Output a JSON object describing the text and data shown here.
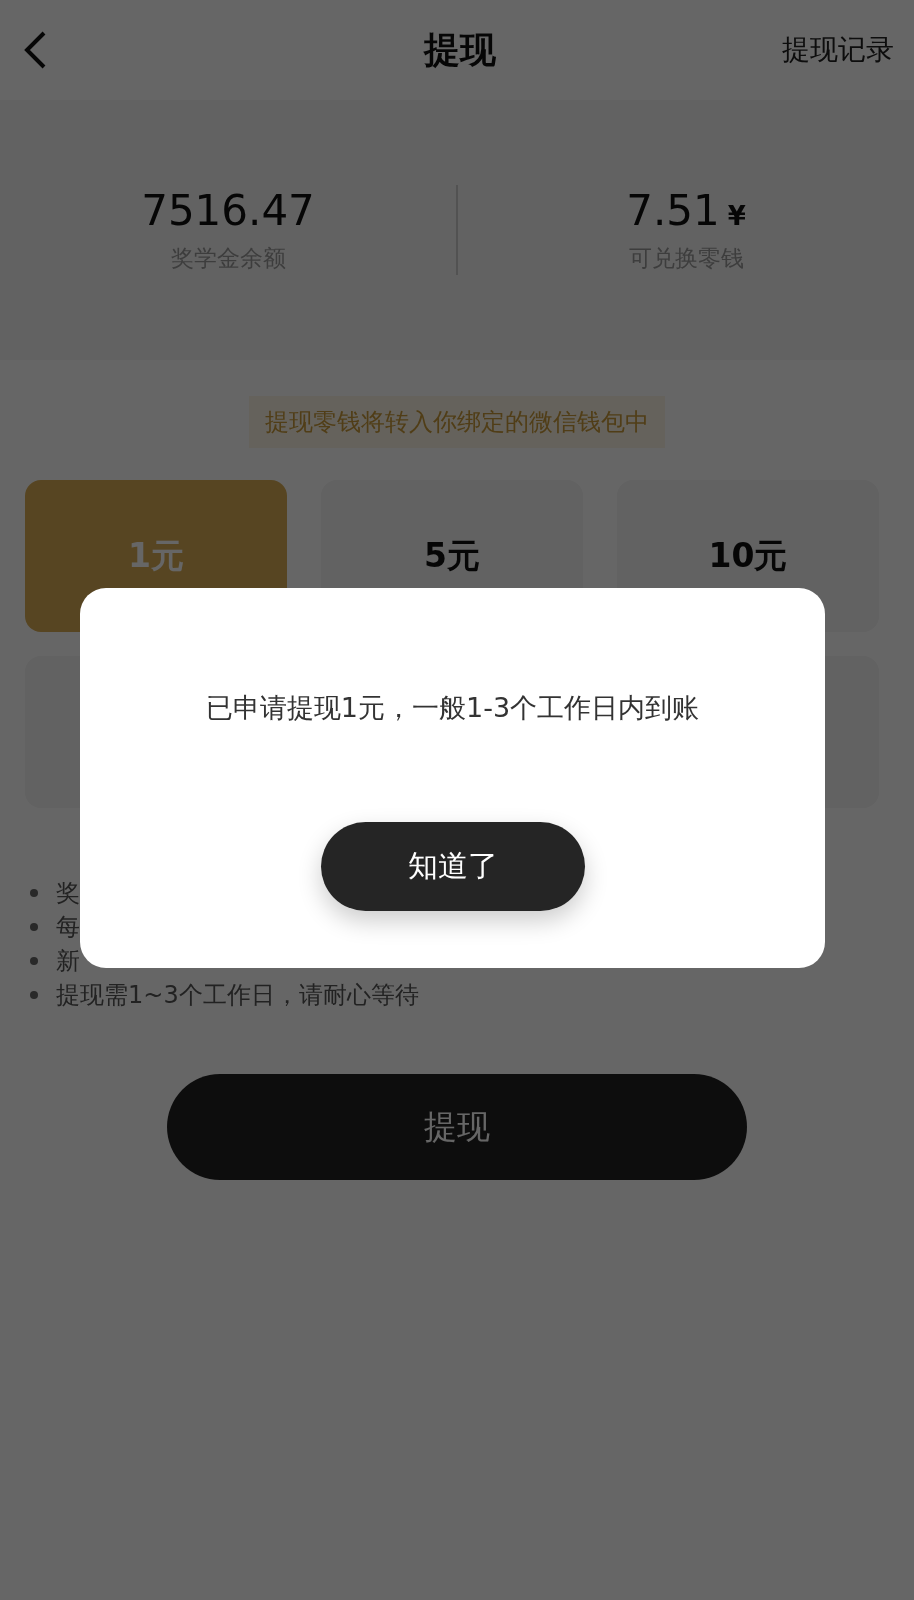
{
  "header": {
    "title": "提现",
    "action": "提现记录"
  },
  "stats": [
    {
      "value": "7516.47",
      "label": "奖学金余额"
    },
    {
      "value": "7.51",
      "unit": "¥",
      "label": "可兑换零钱"
    }
  ],
  "notice": "提现零钱将转入你绑定的微信钱包中",
  "amounts": [
    {
      "label": "1元",
      "selected": true
    },
    {
      "label": "5元",
      "selected": false
    },
    {
      "label": "10元",
      "selected": false
    },
    {
      "selected": false
    },
    {
      "selected": false
    }
  ],
  "rules": [
    "奖",
    "每",
    "新",
    "提现需1~3个工作日，请耐心等待"
  ],
  "submit": "提现",
  "dialog": {
    "message": "已申请提现1元，一般1-3个工作日内到账",
    "button": "知道了"
  }
}
